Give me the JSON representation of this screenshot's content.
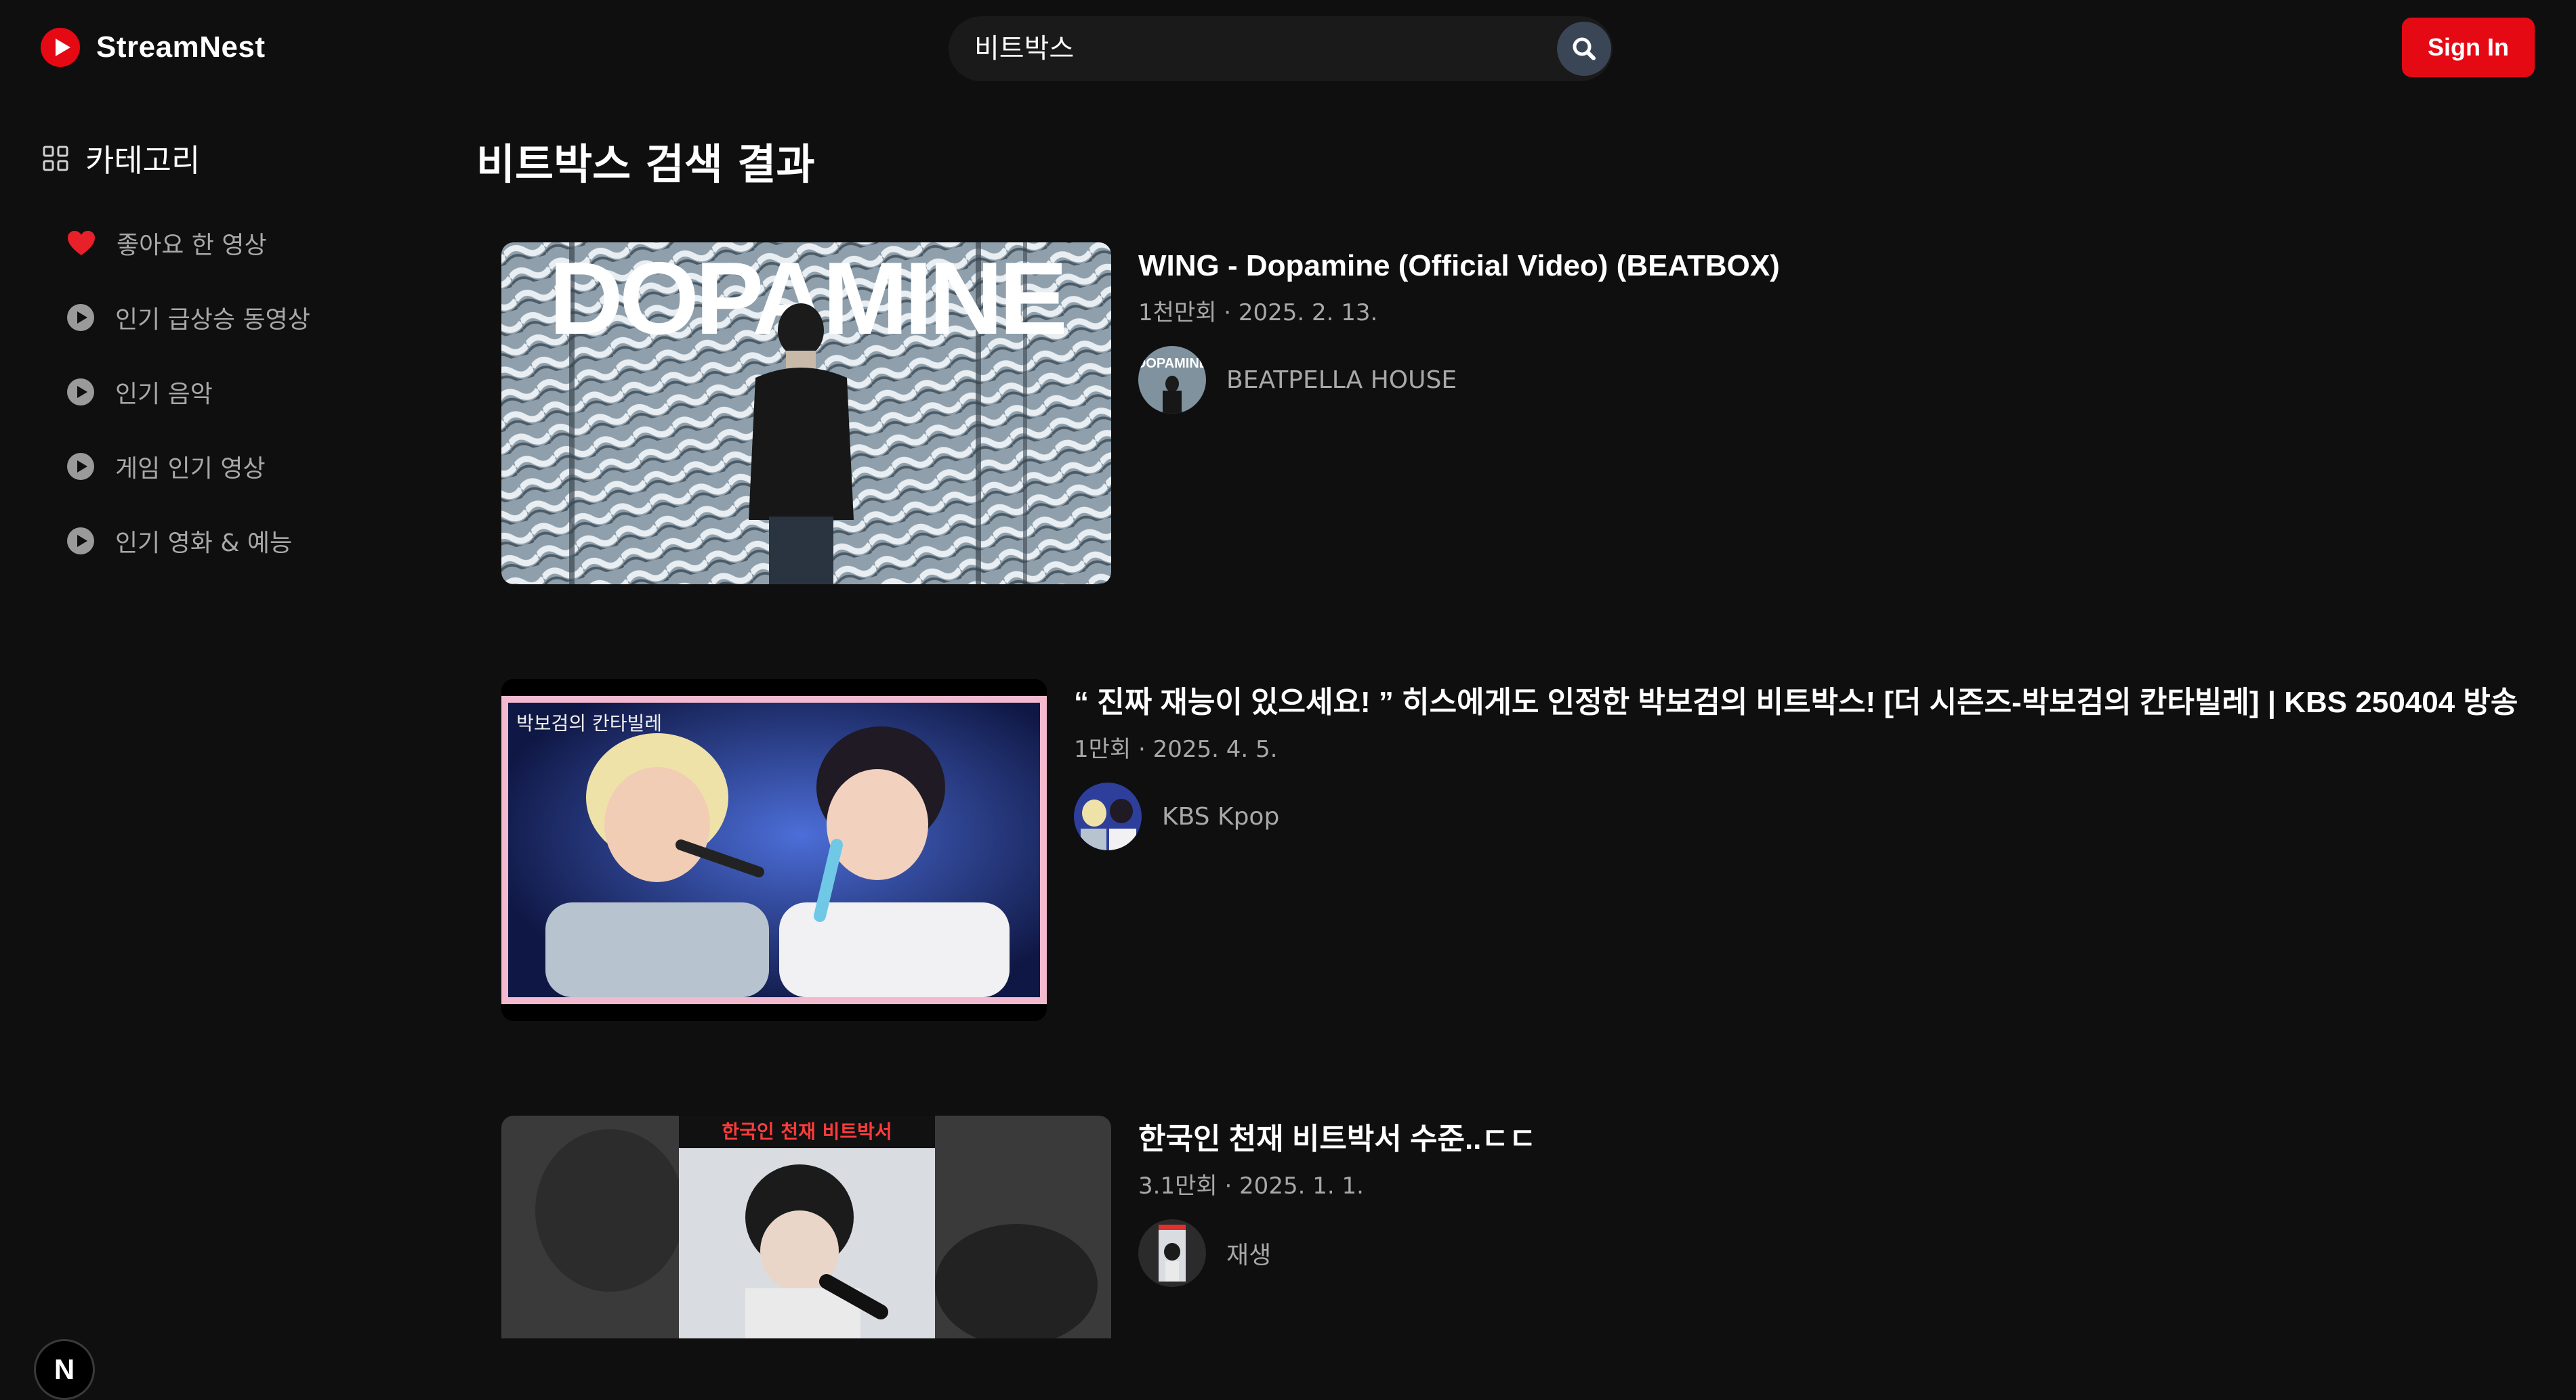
{
  "app": {
    "name": "StreamNest",
    "brand_color": "#e50914"
  },
  "header": {
    "search_value": "비트박스",
    "search_icon": "search-icon",
    "signin_label": "Sign In"
  },
  "sidebar": {
    "title": "카테고리",
    "title_icon": "grid-icon",
    "items": [
      {
        "label": "좋아요 한 영상",
        "icon": "heart-icon"
      },
      {
        "label": "인기 급상승 동영상",
        "icon": "play-circle-icon"
      },
      {
        "label": "인기 음악",
        "icon": "play-circle-icon"
      },
      {
        "label": "게임 인기 영상",
        "icon": "play-circle-icon"
      },
      {
        "label": "인기 영화 & 예능",
        "icon": "play-circle-icon"
      }
    ],
    "badge": "N"
  },
  "main": {
    "title": "비트박스 검색 결과",
    "results": [
      {
        "title": "WING - Dopamine (Official Video) (BEATBOX)",
        "meta": "1천만회 · 2025. 2. 13.",
        "channel": "BEATPELLA HOUSE",
        "thumb_text": "DOPAMINE",
        "avatar_text": "DOPAMINE"
      },
      {
        "title": "“ 진짜 재능이 있으세요! ” 히스에게도 인정한 박보검의 비트박스! [더 시즌즈-박보검의 칸타빌레] | KBS 250404 방송",
        "meta": "1만회 · 2025. 4. 5.",
        "channel": "KBS Kpop",
        "thumb_text": "박보검의 칸타빌레"
      },
      {
        "title": "한국인 천재 비트박서 수준..ㄷㄷ",
        "meta": "3.1만회 · 2025. 1. 1.",
        "channel": "재생",
        "thumb_text": "한국인 천재 비트박서"
      }
    ]
  }
}
